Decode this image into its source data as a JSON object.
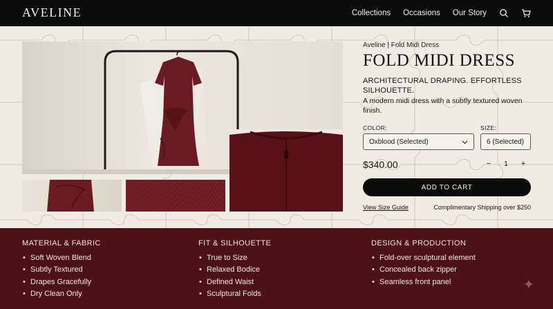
{
  "header": {
    "logo": "AVELINE",
    "nav": [
      "Collections",
      "Occasions",
      "Our Story"
    ],
    "icons": [
      "search-icon",
      "cart-icon"
    ]
  },
  "product": {
    "brand_line": "Aveline | Fold Midi Dress",
    "title": "FOLD MIDI DRESS",
    "subtitle": "ARCHITECTURAL DRAPING. EFFORTLESS SILHOUETTE.",
    "description": "A modern midi dress with a subtly textured woven finish.",
    "color_label": "COLOR:",
    "color_value": "Oxblood (Selected)",
    "size_label": "SIZE:",
    "size_value": "6 (Selected)",
    "price": "$340.00",
    "quantity": "1",
    "qty_minus": "−",
    "qty_plus": "+",
    "add_to_cart": "ADD TO CART",
    "size_guide": "View Size Guide",
    "shipping": "Complimentary Shipping over $250"
  },
  "features": [
    {
      "title": "MATERIAL & FABRIC",
      "items": [
        "Soft Woven Blend",
        "Subtly Textured",
        "Drapes Gracefully",
        "Dry Clean Only"
      ]
    },
    {
      "title": "FIT & SILHOUETTE",
      "items": [
        "True to Size",
        "Relaxed Bodice",
        "Defined Waist",
        "Sculptural Folds"
      ]
    },
    {
      "title": "DESIGN & PRODUCTION",
      "items": [
        "Fold-over sculptural element",
        "Concealed back zipper",
        "Seamless front panel"
      ]
    }
  ],
  "colors": {
    "header_bg": "#0b0b0b",
    "page_bg": "#f1ece3",
    "accent_oxblood": "#4d1217",
    "dress": "#6a1a22"
  }
}
